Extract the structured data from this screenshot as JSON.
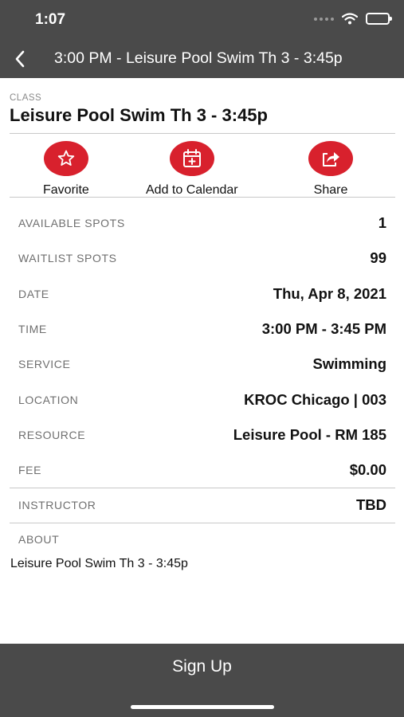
{
  "status": {
    "time": "1:07"
  },
  "nav": {
    "title": "3:00 PM - Leisure Pool Swim Th 3 - 3:45p"
  },
  "class": {
    "label": "CLASS",
    "name": "Leisure Pool Swim Th 3 - 3:45p"
  },
  "actions": {
    "favorite": "Favorite",
    "calendar": "Add to Calendar",
    "share": "Share"
  },
  "details": [
    {
      "key": "AVAILABLE SPOTS",
      "value": "1"
    },
    {
      "key": "WAITLIST SPOTS",
      "value": "99"
    },
    {
      "key": "DATE",
      "value": "Thu, Apr 8, 2021"
    },
    {
      "key": "TIME",
      "value": "3:00 PM - 3:45 PM"
    },
    {
      "key": "SERVICE",
      "value": "Swimming"
    },
    {
      "key": "LOCATION",
      "value": "KROC Chicago | 003"
    },
    {
      "key": "RESOURCE",
      "value": "Leisure Pool - RM 185"
    },
    {
      "key": "FEE",
      "value": "$0.00"
    },
    {
      "key": "INSTRUCTOR",
      "value": "TBD"
    }
  ],
  "about": {
    "label": "ABOUT",
    "text": "Leisure Pool Swim Th 3 - 3:45p"
  },
  "signup": {
    "label": "Sign Up"
  },
  "colors": {
    "header": "#4a4a4a",
    "accent": "#d8212d"
  },
  "icons": [
    "back-chevron-icon",
    "wifi-icon",
    "battery-icon",
    "star-icon",
    "calendar-add-icon",
    "share-icon"
  ]
}
